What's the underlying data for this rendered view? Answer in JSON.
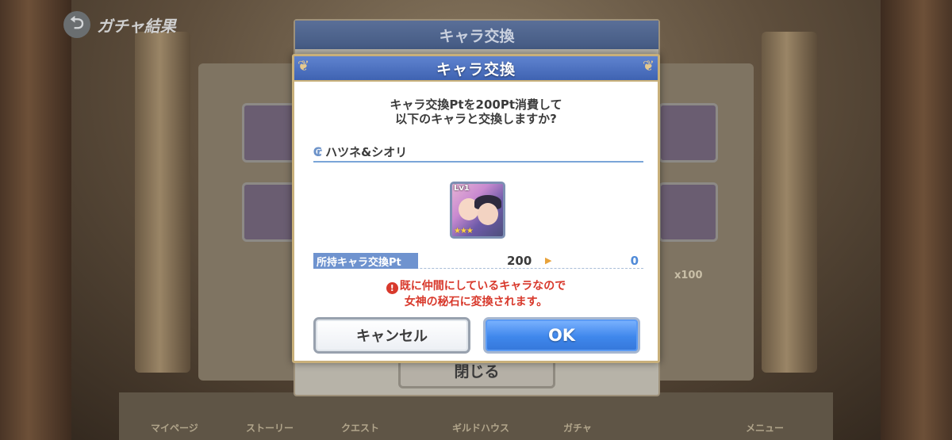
{
  "screen": {
    "title": "ガチャ結果",
    "back_icon": "back-arrow-icon"
  },
  "background": {
    "under_dialog_title": "キャラ交換",
    "close_label": "閉じる",
    "count_badge": "x100",
    "footer_tabs": [
      "マイページ",
      "ストーリー",
      "クエスト",
      "ギルドハウス",
      "ガチャ",
      "メニュー"
    ]
  },
  "dialog": {
    "title": "キャラ交換",
    "message_line1": "キャラ交換Ptを200Pt消費して",
    "message_line2": "以下のキャラと交換しますか?",
    "character_name": "ハツネ&シオリ",
    "character_level": "Lv1",
    "character_stars": "★★★",
    "points_label": "所持キャラ交換Pt",
    "points_before": "200",
    "points_after": "0",
    "warning_line1": "既に仲間にしているキャラなので",
    "warning_line2": "女神の秘石に変換されます。",
    "cancel_label": "キャンセル",
    "ok_label": "OK"
  },
  "colors": {
    "header_blue": "#3f63b2",
    "ok_blue": "#3f87ec",
    "warning_red": "#d8392c",
    "gold_border": "#c9b07a"
  }
}
